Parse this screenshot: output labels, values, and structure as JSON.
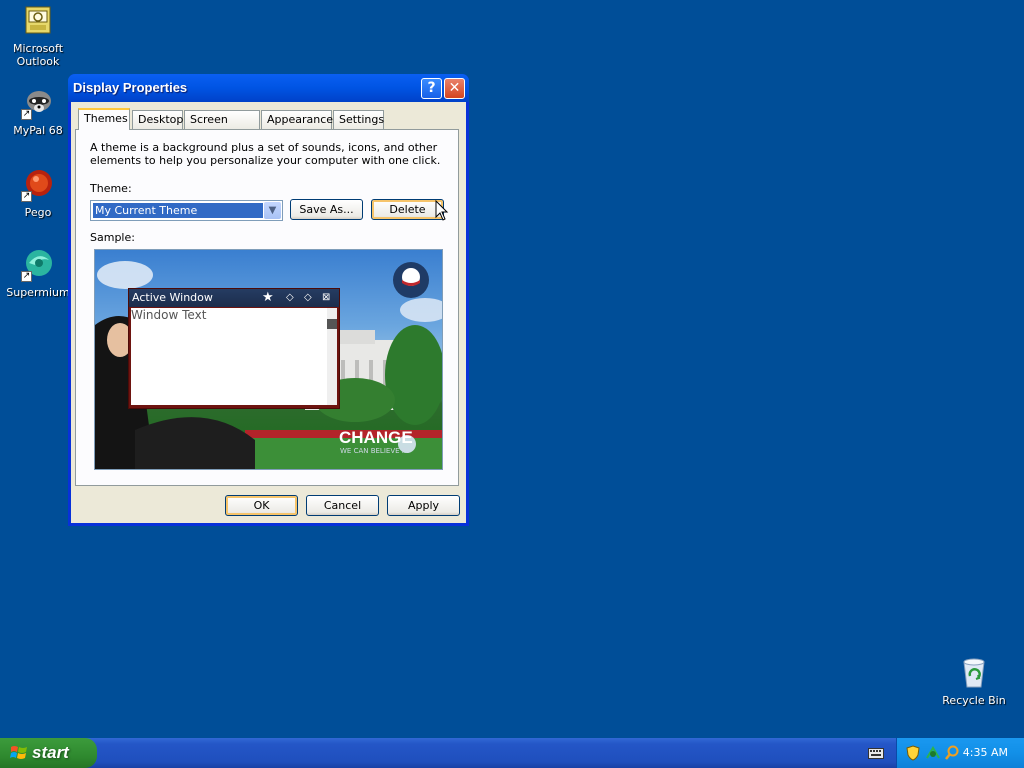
{
  "desktop": {
    "icons": [
      {
        "label": "Microsoft Outlook",
        "icon": "outlook-icon"
      },
      {
        "label": "MyPal 68",
        "icon": "mypal-icon"
      },
      {
        "label": "Pego",
        "icon": "pego-icon"
      },
      {
        "label": "Supermium",
        "icon": "supermium-icon"
      },
      {
        "label": "Recycle Bin",
        "icon": "recycle-bin-icon"
      }
    ]
  },
  "dialog": {
    "title": "Display Properties",
    "help_glyph": "?",
    "close_glyph": "✕",
    "tabs": [
      {
        "label": "Themes",
        "active": true
      },
      {
        "label": "Desktop"
      },
      {
        "label": "Screen Saver"
      },
      {
        "label": "Appearance"
      },
      {
        "label": "Settings"
      }
    ],
    "description": "A theme is a background plus a set of sounds, icons, and other elements to help you personalize your computer with one click.",
    "theme_label": "Theme:",
    "theme_value": "My Current Theme",
    "save_as": "Save As...",
    "delete": "Delete",
    "sample_label": "Sample:",
    "preview": {
      "window_title": "Active Window",
      "window_text": "Window Text",
      "wallpaper_text": "CHANGE",
      "wallpaper_subtext": "WE CAN BELIEVE IN"
    },
    "buttons": {
      "ok": "OK",
      "cancel": "Cancel",
      "apply": "Apply"
    }
  },
  "taskbar": {
    "start_label": "start",
    "clock": "4:35 AM"
  },
  "colors": {
    "desktop_bg": "#004e98",
    "dialog_frame": "#0831d9",
    "selection": "#316ac5"
  }
}
